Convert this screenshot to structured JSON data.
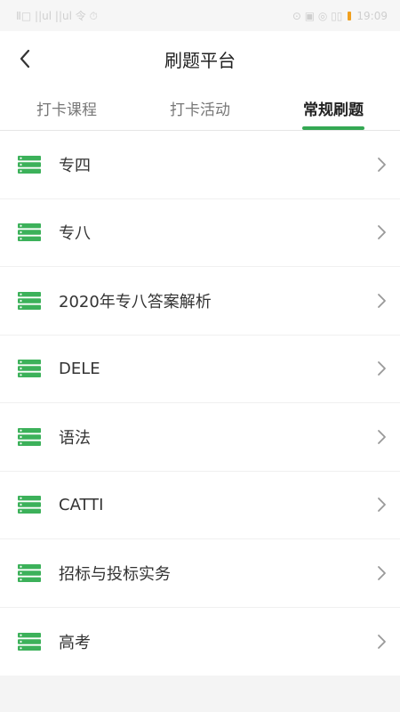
{
  "status_bar": {
    "left_text": "Ⅱ□ ||ul ||ul 令 ⏱",
    "right_text": "⊙ ▣ ◎ ▯▯",
    "time": "19:09"
  },
  "header": {
    "title": "刷题平台",
    "back_icon": "chevron-left-icon"
  },
  "tabs": [
    {
      "label": "打卡课程",
      "active": false
    },
    {
      "label": "打卡活动",
      "active": false
    },
    {
      "label": "常规刷题",
      "active": true
    }
  ],
  "items": [
    {
      "label": "专四"
    },
    {
      "label": "专八"
    },
    {
      "label": "2020年专八答案解析"
    },
    {
      "label": "DELE"
    },
    {
      "label": "语法"
    },
    {
      "label": "CATTI"
    },
    {
      "label": "招标与投标实务"
    },
    {
      "label": "高考"
    }
  ],
  "colors": {
    "accent": "#34a853",
    "icon_green": "#3cb15a"
  }
}
